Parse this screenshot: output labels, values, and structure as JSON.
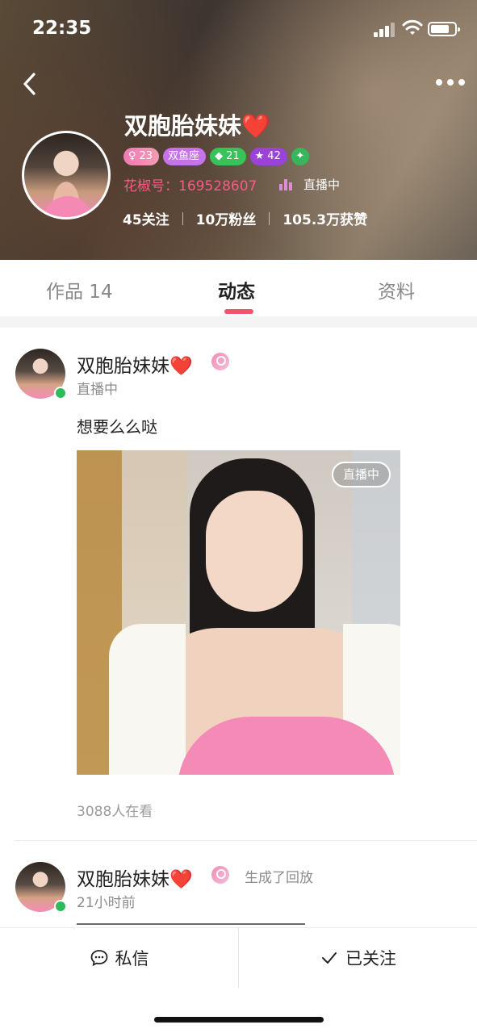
{
  "status_bar": {
    "time": "22:35"
  },
  "profile": {
    "name": "双胞胎妹妹❤️",
    "badges": [
      {
        "icon": "female-icon",
        "text": "23",
        "color": "#f07ab2"
      },
      {
        "icon": "",
        "text": "双鱼座",
        "color": "#c574e8"
      },
      {
        "icon": "diamond-icon",
        "text": "21",
        "color": "#38c25a"
      },
      {
        "icon": "star-icon",
        "text": "42",
        "color": "#9b43d6"
      },
      {
        "icon": "verified-icon",
        "text": "",
        "color": "#34b85b"
      }
    ],
    "id_label": "花椒号：",
    "id_value": "169528607",
    "live_status": "直播中",
    "stats": {
      "following": "45关注",
      "fans": "10万粉丝",
      "likes": "105.3万获赞"
    }
  },
  "tabs": [
    {
      "label": "作品 14",
      "active": false
    },
    {
      "label": "动态",
      "active": true
    },
    {
      "label": "资料",
      "active": false
    }
  ],
  "feed": [
    {
      "name": "双胞胎妹妹❤️",
      "subtitle": "直播中",
      "text": "想要么么哒",
      "photo_label": "直播中",
      "viewers": "3088人在看"
    },
    {
      "name": "双胞胎妹妹❤️",
      "action": "生成了回放",
      "subtitle": "21小时前"
    }
  ],
  "bottom_bar": {
    "message": "私信",
    "followed": "已关注"
  }
}
